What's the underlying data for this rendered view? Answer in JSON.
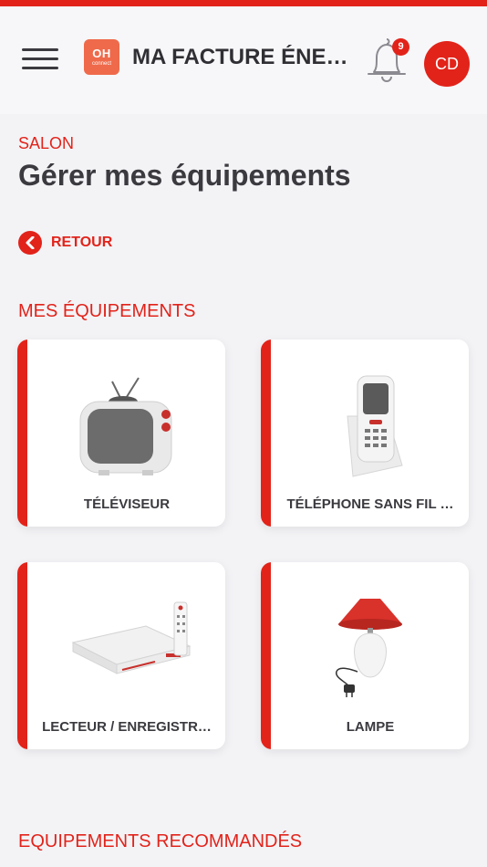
{
  "header": {
    "title": "MA FACTURE ÉNERGÉTIQUE",
    "logo": {
      "top": "OH",
      "bottom": "connect"
    },
    "notifications": {
      "count": "9",
      "icon": "bell-icon"
    },
    "avatar_initials": "CD",
    "menu_icon": "hamburger-menu-icon"
  },
  "page": {
    "room": "SALON",
    "title": "Gérer mes équipements",
    "back_label": "RETOUR"
  },
  "sections": {
    "my_equipment": "MES ÉQUIPEMENTS",
    "recommended": "EQUIPEMENTS RECOMMANDÉS"
  },
  "equipment": [
    {
      "label": "TÉLÉVISEUR",
      "icon": "tv-icon"
    },
    {
      "label": "TÉLÉPHONE SANS FIL …",
      "icon": "cordless-phone-icon"
    },
    {
      "label": "LECTEUR / ENREGISTR…",
      "icon": "dvd-recorder-icon"
    },
    {
      "label": "LAMPE",
      "icon": "lamp-icon"
    }
  ],
  "colors": {
    "accent": "#e2231a",
    "logo": "#ef6a4b",
    "text": "#3a3a3f",
    "background": "#f3f3f6"
  }
}
